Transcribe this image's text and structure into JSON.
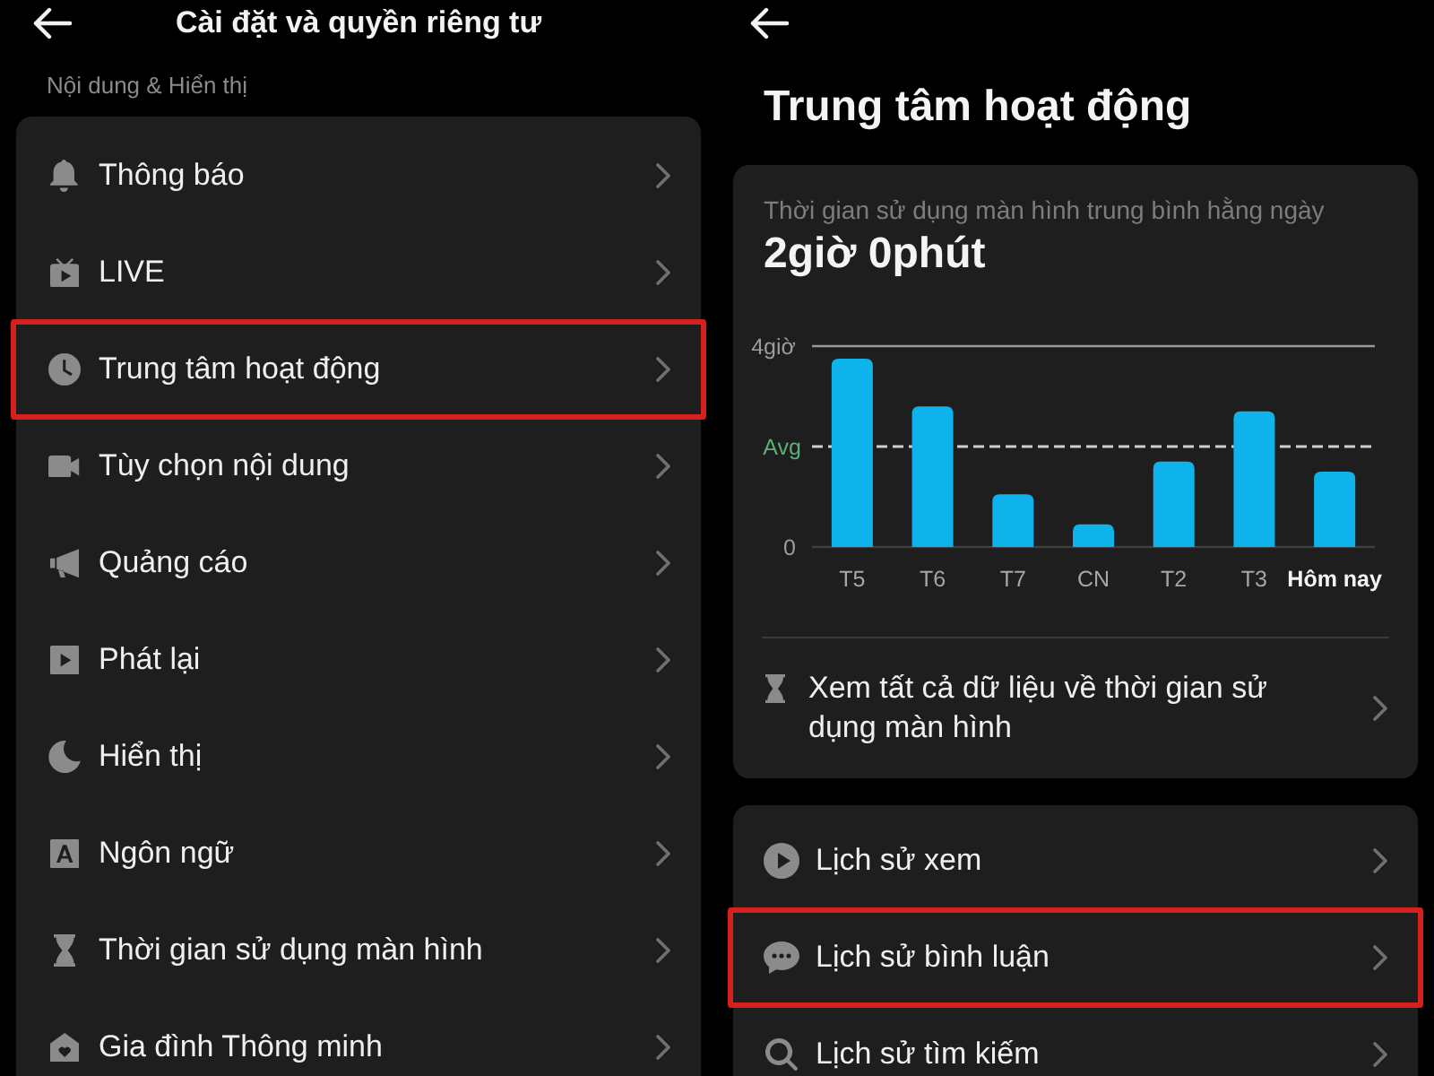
{
  "left_screen": {
    "header": {
      "title": "Cài đặt và quyền riêng tư"
    },
    "section_label": "Nội dung & Hiển thị",
    "menu": [
      {
        "label": "Thông báo",
        "highlighted": false
      },
      {
        "label": "LIVE",
        "highlighted": false
      },
      {
        "label": "Trung tâm hoạt động",
        "highlighted": true
      },
      {
        "label": "Tùy chọn nội dung",
        "highlighted": false
      },
      {
        "label": "Quảng cáo",
        "highlighted": false
      },
      {
        "label": "Phát lại",
        "highlighted": false
      },
      {
        "label": "Hiển thị",
        "highlighted": false
      },
      {
        "label": "Ngôn ngữ",
        "highlighted": false
      },
      {
        "label": "Thời gian sử dụng màn hình",
        "highlighted": false
      },
      {
        "label": "Gia đình Thông minh",
        "highlighted": false
      }
    ]
  },
  "right_screen": {
    "heading": "Trung tâm hoạt động",
    "usage_card": {
      "subtitle": "Thời gian sử dụng màn hình trung bình hằng ngày",
      "total": "2giờ 0phút",
      "chart_data": {
        "type": "bar",
        "categories": [
          "T5",
          "T6",
          "T7",
          "CN",
          "T2",
          "T3",
          "Hôm nay"
        ],
        "values": [
          3.75,
          2.8,
          1.05,
          0.45,
          1.7,
          2.7,
          1.5
        ],
        "ylim": [
          0,
          4
        ],
        "yticks": [
          {
            "value": 0,
            "label": "0"
          },
          {
            "value": 2,
            "label": "Avg"
          },
          {
            "value": 4,
            "label": "4giờ"
          }
        ]
      },
      "today_highlighted": true,
      "link": "Xem tất cả dữ liệu về thời gian sử dụng màn hình"
    },
    "history_menu": [
      {
        "label": "Lịch sử xem",
        "highlighted": false
      },
      {
        "label": "Lịch sử bình luận",
        "highlighted": true
      },
      {
        "label": "Lịch sử tìm kiếm",
        "highlighted": false
      }
    ]
  }
}
